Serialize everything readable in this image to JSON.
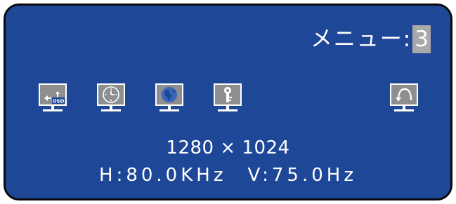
{
  "menu": {
    "title": "メニュー:",
    "page_number": "3"
  },
  "icons": [
    {
      "name": "osd-settings-icon",
      "label": "OSD"
    },
    {
      "name": "clock-icon"
    },
    {
      "name": "globe-icon"
    },
    {
      "name": "key-lock-icon"
    },
    {
      "name": "reset-icon"
    }
  ],
  "info": {
    "resolution": "1280 × 1024",
    "h_freq": "H:80.0KHz",
    "v_freq": "V:75.0Hz"
  },
  "colors": {
    "panel_background": "#1f4798",
    "icon_background": "#8e8e8e",
    "page_highlight": "#a9a9a9",
    "text": "#ffffff"
  }
}
